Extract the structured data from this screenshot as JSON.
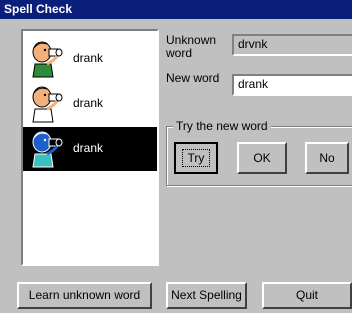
{
  "window": {
    "title": "Spell Check"
  },
  "list": {
    "items": [
      {
        "word": "drank",
        "icon": "person-drinking-icon",
        "selected": false
      },
      {
        "word": "drank",
        "icon": "person-drinking-icon",
        "selected": false
      },
      {
        "word": "drank",
        "icon": "person-drinking-icon",
        "selected": true
      }
    ]
  },
  "unknown": {
    "label_line1": "Unknown",
    "label_line2": "word",
    "value": "drvnk"
  },
  "new_word": {
    "label": "New word",
    "value": "drank"
  },
  "try_group": {
    "title": "Try the new word",
    "try_label": "Try",
    "ok_label": "OK",
    "no_label": "No"
  },
  "bottom": {
    "learn_label": "Learn unknown word",
    "next_label": "Next Spelling",
    "quit_label": "Quit"
  },
  "colors": {
    "title_bar": "#0a1f7a",
    "face": "#c0c0c0",
    "selected_bg": "#000000"
  }
}
